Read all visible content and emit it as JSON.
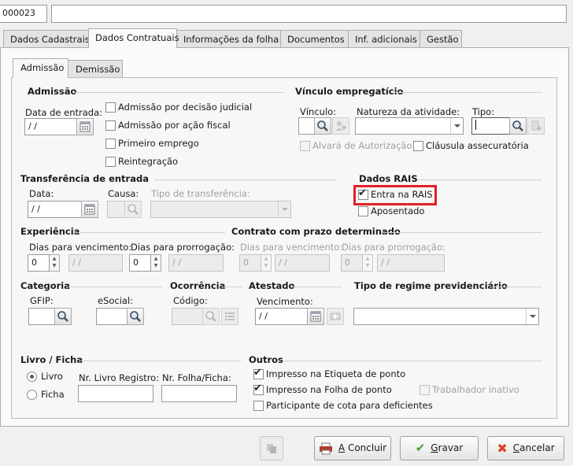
{
  "top": {
    "code_value": "000023",
    "name_value": ""
  },
  "tabs": [
    "Dados Cadastrais",
    "Dados Contratuais",
    "Informações da folha",
    "Documentos",
    "Inf. adicionais",
    "Gestão"
  ],
  "subtabs": [
    "Admissão",
    "Demissão"
  ],
  "admissao": {
    "title": "Admissão",
    "data_label": "Data de entrada:",
    "data_value": " /  /",
    "options": [
      "Admissão por decisão judicial",
      "Admissão por ação fiscal",
      "Primeiro emprego",
      "Reintegração"
    ]
  },
  "vinculo": {
    "title": "Vínculo empregatício",
    "vinculo_label": "Vínculo:",
    "natureza_label": "Natureza da atividade:",
    "tipo_label": "Tipo:",
    "alvara_label": "Alvará de Autorização",
    "clausula_label": "Cláusula assecuratória"
  },
  "transferencia": {
    "title": "Transferência de entrada",
    "data_label": "Data:",
    "data_value": " /  /",
    "causa_label": "Causa:",
    "tipo_label": "Tipo de transferência:"
  },
  "rais": {
    "title": "Dados RAIS",
    "entra_label": "Entra na RAIS",
    "entra_checked": true,
    "aposentado_label": "Aposentado",
    "highlight_color": "#e31f26"
  },
  "experiencia": {
    "title": "Experiência",
    "venc_label": "Dias para vencimento:",
    "prorr_label": "Dias para prorrogação:",
    "venc_value": "0",
    "venc_date": " /  /",
    "prorr_value": "0",
    "prorr_date": " /  /"
  },
  "contrato": {
    "title": "Contrato com prazo determinado",
    "venc_label": "Dias para vencimento:",
    "prorr_label": "Dias para prorrogação:",
    "venc_value": "0",
    "venc_date": " /  /",
    "prorr_value": "0",
    "prorr_date": " /  /"
  },
  "categoria": {
    "title": "Categoria",
    "gfip_label": "GFIP:",
    "esocial_label": "eSocial:"
  },
  "ocorrencia": {
    "title": "Ocorrência",
    "codigo_label": "Código:"
  },
  "atestado": {
    "title": "Atestado",
    "venc_label": "Vencimento:",
    "venc_value": " /  /"
  },
  "regime": {
    "title": "Tipo de regime previdenciário"
  },
  "livro": {
    "title": "Livro / Ficha",
    "livro_label": "Livro",
    "ficha_label": "Ficha",
    "nr_livro_label": "Nr. Livro Registro:",
    "nr_folha_label": "Nr. Folha/Ficha:"
  },
  "outros": {
    "title": "Outros",
    "etiqueta_label": "Impresso na Etiqueta de ponto",
    "folha_label": "Impresso na Folha de ponto",
    "trabalhador_label": "Trabalhador inativo",
    "cota_label": "Participante de cota para deficientes"
  },
  "footer": {
    "concluir_hot": "A",
    "concluir_rest": " Concluir",
    "gravar_hot": "G",
    "gravar_rest": "ravar",
    "cancelar_hot": "C",
    "cancelar_rest": "ancelar"
  },
  "colors": {
    "gravar_icon": "#4aa02c",
    "cancelar_icon": "#d9482b"
  }
}
